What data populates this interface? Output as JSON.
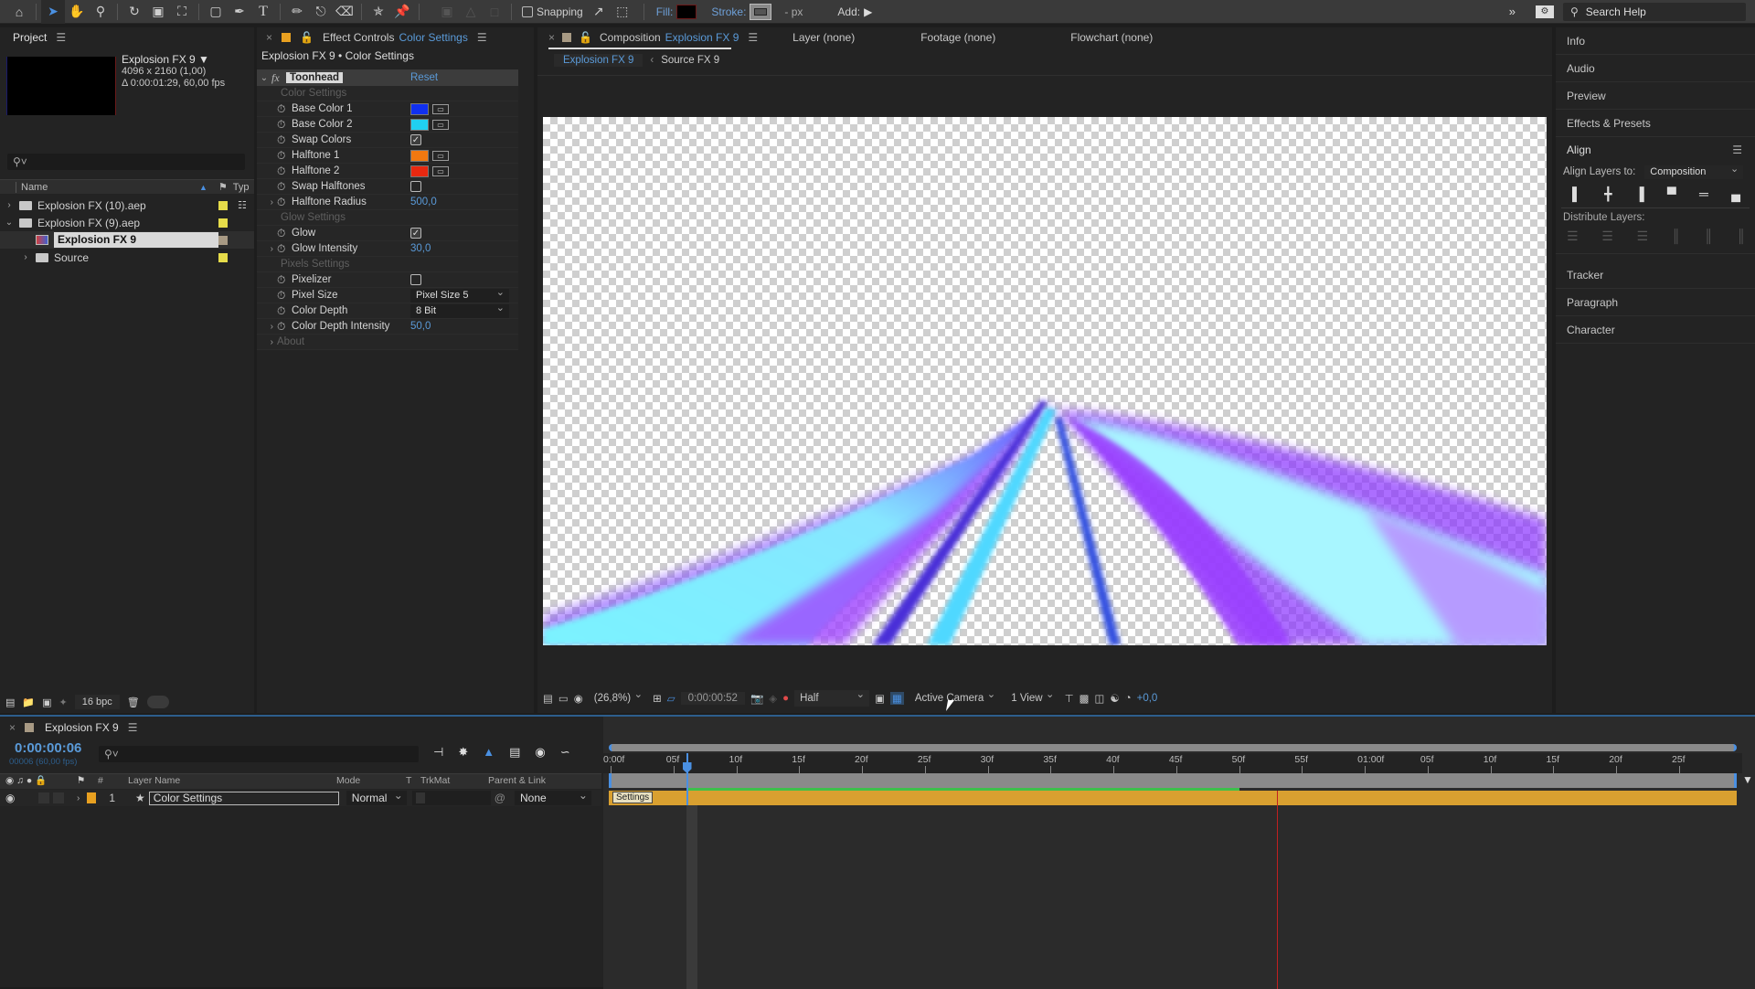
{
  "toolbar": {
    "tools": [
      "home-icon",
      "selection-tool-icon",
      "hand-tool-icon",
      "zoom-tool-icon",
      "rotation-tool-icon",
      "camera-tool-icon",
      "pan-behind-tool-icon",
      "rectangle-tool-icon",
      "pen-tool-icon",
      "type-tool-icon",
      "brush-tool-icon",
      "clone-stamp-tool-icon",
      "eraser-tool-icon",
      "roto-brush-tool-icon",
      "puppet-pin-tool-icon"
    ],
    "snapping_label": "Snapping",
    "snapping_checked": false,
    "fill_label": "Fill:",
    "fill_color": "#000000",
    "stroke_label": "Stroke:",
    "stroke_px": "- px",
    "add_label": "Add:",
    "search_help": "Search Help"
  },
  "project": {
    "title": "Project",
    "selected_name": "Explosion FX 9 ▼",
    "dimensions": "4096 x 2160 (1,00)",
    "duration": "Δ 0:00:01:29, 60,00 fps",
    "search_placeholder": "",
    "columns": {
      "name": "Name",
      "type": "Typ"
    },
    "items": [
      {
        "name": "Explosion FX (10).aep",
        "kind": "folder",
        "expanded": false,
        "indent": 0,
        "label_color": "#e6dc4a"
      },
      {
        "name": "Explosion FX (9).aep",
        "kind": "folder",
        "expanded": true,
        "indent": 0,
        "label_color": "#e6dc4a"
      },
      {
        "name": "Explosion FX 9",
        "kind": "composition",
        "selected": true,
        "indent": 1,
        "label_color": "#a89a84"
      },
      {
        "name": "Source",
        "kind": "folder",
        "expanded": false,
        "indent": 1,
        "label_color": "#e6dc4a"
      }
    ],
    "bpc": "16 bpc"
  },
  "effect_controls": {
    "tab_prefix": "Effect Controls",
    "tab_layer": "Color Settings",
    "subtitle": "Explosion FX 9 • Color Settings",
    "effect_name": "Toonhead",
    "reset": "Reset",
    "rows": [
      {
        "type": "category",
        "label": "Color Settings"
      },
      {
        "type": "color",
        "label": "Base Color 1",
        "color": "#1030f0"
      },
      {
        "type": "color",
        "label": "Base Color 2",
        "color": "#20d0f0"
      },
      {
        "type": "checkbox",
        "label": "Swap Colors",
        "checked": true
      },
      {
        "type": "color",
        "label": "Halftone 1",
        "color": "#f07810"
      },
      {
        "type": "color",
        "label": "Halftone 2",
        "color": "#e82810"
      },
      {
        "type": "checkbox",
        "label": "Swap Halftones",
        "checked": false
      },
      {
        "type": "number",
        "label": "Halftone Radius",
        "value": "500,0",
        "twirl": true
      },
      {
        "type": "category",
        "label": "Glow Settings"
      },
      {
        "type": "checkbox",
        "label": "Glow",
        "checked": true
      },
      {
        "type": "number",
        "label": "Glow Intensity",
        "value": "30,0",
        "twirl": true
      },
      {
        "type": "category",
        "label": "Pixels Settings"
      },
      {
        "type": "checkbox",
        "label": "Pixelizer",
        "checked": false
      },
      {
        "type": "dropdown",
        "label": "Pixel Size",
        "value": "Pixel Size 5"
      },
      {
        "type": "dropdown",
        "label": "Color Depth",
        "value": "8 Bit"
      },
      {
        "type": "number",
        "label": "Color Depth Intensity",
        "value": "50,0",
        "twirl": true
      },
      {
        "type": "category",
        "label": "About",
        "twirl": true
      }
    ]
  },
  "composition": {
    "tab_prefix": "Composition",
    "tab_name": "Explosion FX 9",
    "other_tabs": [
      "Layer (none)",
      "Footage (none)",
      "Flowchart (none)"
    ],
    "breadcrumbs": [
      "Explosion FX 9",
      "Source FX 9"
    ],
    "viewer_bar": {
      "zoom": "(26,8%)",
      "timecode": "0:00:00:52",
      "resolution": "Half",
      "camera": "Active Camera",
      "views": "1 View",
      "exposure": "+0,0"
    }
  },
  "right_panels": {
    "sections_top": [
      "Info",
      "Audio",
      "Preview",
      "Effects & Presets"
    ],
    "align": {
      "title": "Align",
      "align_to_label": "Align Layers to:",
      "align_to_value": "Composition",
      "distribute_label": "Distribute Layers:"
    },
    "sections_bottom": [
      "Tracker",
      "Paragraph",
      "Character"
    ]
  },
  "timeline": {
    "tab_name": "Explosion FX 9",
    "current_time": "0:00:00:06",
    "frame_info": "00006 (60,00 fps)",
    "columns": {
      "num": "#",
      "layer_name": "Layer Name",
      "mode": "Mode",
      "t": "T",
      "trkmat": "TrkMat",
      "parent": "Parent & Link"
    },
    "layers": [
      {
        "index": "1",
        "name": "Color Settings",
        "mode": "Normal",
        "parent": "None",
        "label_color": "#e8a020",
        "bar_label": "Settings"
      }
    ],
    "ruler_ticks": [
      "0:00f",
      "05f",
      "10f",
      "15f",
      "20f",
      "25f",
      "30f",
      "35f",
      "40f",
      "45f",
      "50f",
      "55f",
      "01:00f",
      "05f",
      "10f",
      "15f",
      "20f",
      "25f"
    ],
    "playhead_frame": 6,
    "render_progress_frames": 50,
    "marker_frame": 53,
    "total_frames": 89
  }
}
